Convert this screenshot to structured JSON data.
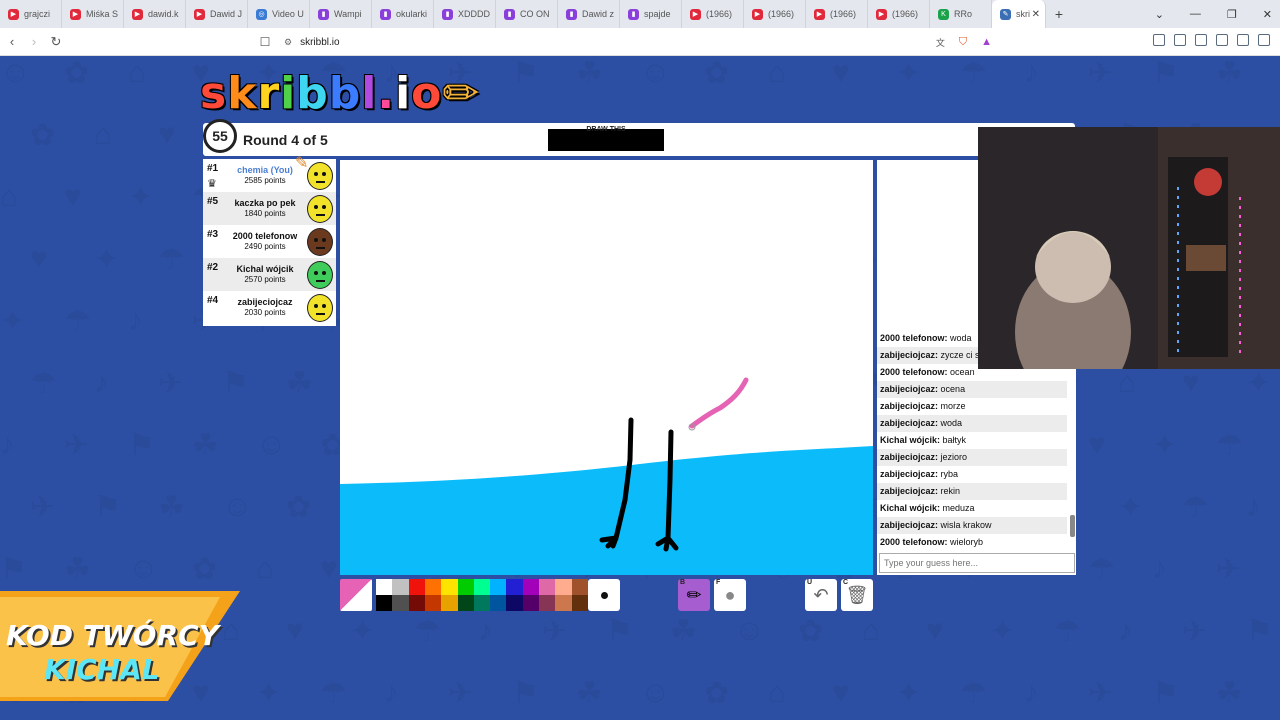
{
  "browser": {
    "tabs": [
      {
        "label": "grajczi",
        "color": "#e0293a",
        "glyph": "▶"
      },
      {
        "label": "Miśka S",
        "color": "#e0293a",
        "glyph": "▶"
      },
      {
        "label": "dawid.k",
        "color": "#e0293a",
        "glyph": "▶"
      },
      {
        "label": "Dawid J",
        "color": "#e0293a",
        "glyph": "▶"
      },
      {
        "label": "Video U",
        "color": "#3a7bd5",
        "glyph": "◎"
      },
      {
        "label": "Wampi",
        "color": "#8a3fdb",
        "glyph": "▮"
      },
      {
        "label": "okularki",
        "color": "#8a3fdb",
        "glyph": "▮"
      },
      {
        "label": "XDDDD",
        "color": "#8a3fdb",
        "glyph": "▮"
      },
      {
        "label": "CO ON",
        "color": "#8a3fdb",
        "glyph": "▮"
      },
      {
        "label": "Dawid z",
        "color": "#8a3fdb",
        "glyph": "▮"
      },
      {
        "label": "spajde",
        "color": "#8a3fdb",
        "glyph": "▮"
      },
      {
        "label": "(1966)",
        "color": "#e0293a",
        "glyph": "▶"
      },
      {
        "label": "(1966)",
        "color": "#e0293a",
        "glyph": "▶"
      },
      {
        "label": "(1966)",
        "color": "#e0293a",
        "glyph": "▶"
      },
      {
        "label": "(1966)",
        "color": "#e0293a",
        "glyph": "▶"
      },
      {
        "label": "RRo",
        "color": "#1aa34a",
        "glyph": "K"
      }
    ],
    "active_tab": {
      "label": "skri",
      "color": "#3a6fb5",
      "glyph": "✎"
    },
    "url": "skribbl.io"
  },
  "game": {
    "logo": "skribbl.io",
    "timer": "55",
    "round": "Round 4 of 5",
    "word_hint_label": "DRAW THIS",
    "players": [
      {
        "rank": "#1",
        "name": "chemia (You)",
        "points": "2585 points",
        "you": true,
        "color": "#f2e32a",
        "crown": true,
        "drawing": true
      },
      {
        "rank": "#5",
        "name": "kaczka po pek",
        "points": "1840 points",
        "you": false,
        "color": "#f2e32a"
      },
      {
        "rank": "#3",
        "name": "2000 telefonow",
        "points": "2490 points",
        "you": false,
        "color": "#6b3a1e"
      },
      {
        "rank": "#2",
        "name": "Kichal wójcik",
        "points": "2570 points",
        "you": false,
        "color": "#3fcc5a"
      },
      {
        "rank": "#4",
        "name": "zabijeciojcaz",
        "points": "2030 points",
        "you": false,
        "color": "#f2e32a"
      }
    ],
    "bubble": "wieloryb",
    "chat": [
      {
        "name": "2000 telefonow:",
        "msg": "woda"
      },
      {
        "name": "zabijeciojcaz:",
        "msg": "zycze ci sm"
      },
      {
        "name": "2000 telefonow:",
        "msg": "ocean"
      },
      {
        "name": "zabijeciojcaz:",
        "msg": "ocena"
      },
      {
        "name": "zabijeciojcaz:",
        "msg": "morze"
      },
      {
        "name": "zabijeciojcaz:",
        "msg": "woda"
      },
      {
        "name": "Kichal wójcik:",
        "msg": "bałtyk"
      },
      {
        "name": "zabijeciojcaz:",
        "msg": "jezioro"
      },
      {
        "name": "zabijeciojcaz:",
        "msg": "ryba"
      },
      {
        "name": "zabijeciojcaz:",
        "msg": "rekin"
      },
      {
        "name": "Kichal wójcik:",
        "msg": "meduza"
      },
      {
        "name": "zabijeciojcaz:",
        "msg": "wisla krakow"
      },
      {
        "name": "2000 telefonow:",
        "msg": "wieloryb"
      }
    ],
    "guess_placeholder": "Type your guess here...",
    "current_color": "#e562b4",
    "palette_top": [
      "#ffffff",
      "#c1c1c1",
      "#ef130b",
      "#ff7100",
      "#ffe400",
      "#00cc00",
      "#00ff91",
      "#00b2ff",
      "#231fd3",
      "#a300ba",
      "#df69a7",
      "#ffac8e",
      "#a0522d"
    ],
    "palette_bottom": [
      "#000000",
      "#505050",
      "#740b07",
      "#c23800",
      "#e8a200",
      "#004619",
      "#00785d",
      "#00569e",
      "#0e0865",
      "#550069",
      "#873554",
      "#cc774d",
      "#63300d"
    ],
    "tools": {
      "brush_key": "B",
      "fill_key": "F",
      "undo_key": "U",
      "clear_key": "C"
    },
    "water_color": "#0cbcfa",
    "stroke_pink": "#e562b4"
  },
  "overlay": {
    "creator_line1": "KOD TWÓRCY",
    "creator_line2": "KICHAL"
  }
}
